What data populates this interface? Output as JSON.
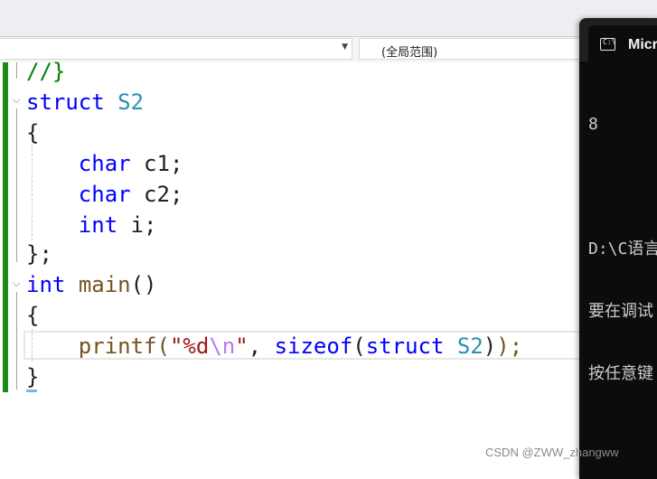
{
  "navigation": {
    "scope_dropdown_value": "",
    "member_dropdown_value": "(全局范围)"
  },
  "editor": {
    "lines": [
      {
        "tokens": [
          {
            "t": "//}",
            "c": "cm"
          }
        ]
      },
      {
        "tokens": [
          {
            "t": "struct",
            "c": "kw"
          },
          {
            "t": " "
          },
          {
            "t": "S2",
            "c": "ty"
          }
        ]
      },
      {
        "tokens": [
          {
            "t": "{"
          }
        ]
      },
      {
        "tokens": [
          {
            "t": "    "
          },
          {
            "t": "char",
            "c": "kw"
          },
          {
            "t": " c1;"
          }
        ]
      },
      {
        "tokens": [
          {
            "t": "    "
          },
          {
            "t": "char",
            "c": "kw"
          },
          {
            "t": " c2;"
          }
        ]
      },
      {
        "tokens": [
          {
            "t": "    "
          },
          {
            "t": "int",
            "c": "kw"
          },
          {
            "t": " i;"
          }
        ]
      },
      {
        "tokens": [
          {
            "t": "};"
          }
        ]
      },
      {
        "tokens": [
          {
            "t": "int",
            "c": "kw"
          },
          {
            "t": " "
          },
          {
            "t": "main",
            "c": "fn"
          },
          {
            "t": "()"
          }
        ]
      },
      {
        "tokens": [
          {
            "t": "{"
          }
        ]
      },
      {
        "tokens": [
          {
            "t": "    "
          },
          {
            "t": "printf",
            "c": "fn"
          },
          {
            "t": "(",
            "c": "fn"
          },
          {
            "t": "\"%d",
            "c": "st"
          },
          {
            "t": "\\n",
            "c": "esc"
          },
          {
            "t": "\"",
            "c": "st"
          },
          {
            "t": ", "
          },
          {
            "t": "sizeof",
            "c": "kw"
          },
          {
            "t": "("
          },
          {
            "t": "struct",
            "c": "kw"
          },
          {
            "t": " "
          },
          {
            "t": "S2",
            "c": "ty"
          },
          {
            "t": ")"
          },
          {
            "t": ");",
            "c": "fn"
          }
        ]
      },
      {
        "tokens": [
          {
            "t": "}"
          }
        ]
      }
    ]
  },
  "console": {
    "tab_title": "Micr",
    "output_lines": [
      "8",
      "",
      "D:\\C语言",
      "要在调试",
      "按任意键"
    ]
  },
  "watermark": "CSDN @ZWW_zhangww"
}
